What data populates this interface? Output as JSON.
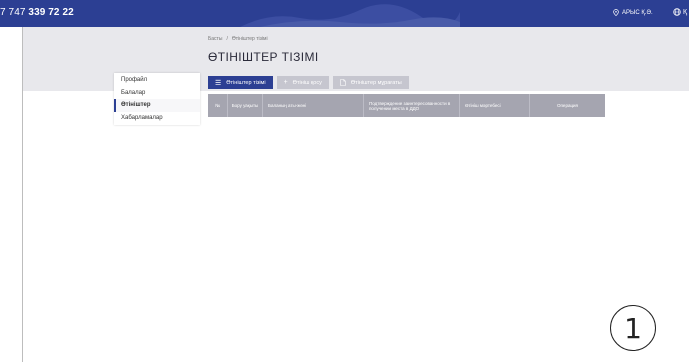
{
  "topbar": {
    "phone_prefix": "7 747 ",
    "phone_bold": "339 72 22",
    "location": "АРЫС Қ.Ә.",
    "lang": "Қ"
  },
  "breadcrumb": {
    "home": "Басты",
    "sep": "/",
    "current": "Өтініштер тізімі"
  },
  "page_title": "ӨТІНІШТЕР ТІЗІМІ",
  "sidebar": {
    "items": [
      {
        "label": "Профайл",
        "active": false
      },
      {
        "label": "Балалар",
        "active": false
      },
      {
        "label": "Өтініштер",
        "active": true
      },
      {
        "label": "Хабарламалар",
        "active": false
      }
    ]
  },
  "tabs": [
    {
      "label": "Өтініштер тізімі",
      "icon": "list-icon"
    },
    {
      "label": "Өтініш қосу",
      "icon": "plus-icon"
    },
    {
      "label": "Өтініштер мұрағаты",
      "icon": "document-icon"
    }
  ],
  "table": {
    "columns": [
      "№",
      "Бору уақыты",
      "Баланың аты-жөні",
      "Подтверждение заинтересованности в получении места в ДДО",
      "Өтініш мәртебесі",
      "Операция"
    ]
  },
  "overlay_number": "1",
  "colors": {
    "primary": "#2c3f93",
    "header_band": "#e8e8ec",
    "table_header": "#a5a5b0"
  }
}
